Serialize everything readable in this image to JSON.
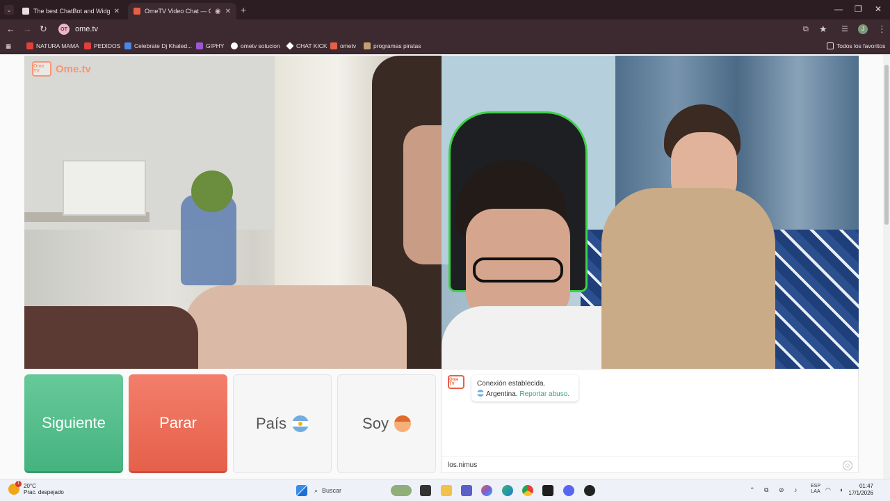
{
  "browser": {
    "tabs": [
      {
        "title": "The best ChatBot and Widgets",
        "active": false
      },
      {
        "title": "OmeTV Video Chat — Ome",
        "active": true
      }
    ],
    "url": "ome.tv",
    "site_badge": "OT"
  },
  "bookmarks": [
    {
      "label": "NATURA MAMA",
      "color": "#e0403a"
    },
    {
      "label": "PEDIDOS",
      "color": "#e0403a"
    },
    {
      "label": "Celebrate Dj Khaled...",
      "color": "#4a86e8"
    },
    {
      "label": "GIPHY",
      "color": "#9b59d0"
    },
    {
      "label": "ometv solucion",
      "color": "#ffffff"
    },
    {
      "label": "CHAT KICK",
      "color": "#ffffff"
    },
    {
      "label": "ometv",
      "color": "#e95f46"
    },
    {
      "label": "programas piratas",
      "color": "#c2a070"
    }
  ],
  "bookmarks_folder": "Todos los favoritos",
  "logo": {
    "badge": "Ome TV",
    "text": "Ome.tv"
  },
  "buttons": {
    "next": "Siguiente",
    "stop": "Parar",
    "country": "País",
    "soy": "Soy"
  },
  "chat": {
    "logo_badge": "Ome TV",
    "status": "Conexión establecida.",
    "country": "Argentina.",
    "report": "Reportar abuso.",
    "input_value": "los.nimus"
  },
  "taskbar": {
    "temperature": "20°C",
    "weather": "Prac. despejado",
    "weather_badge": "1",
    "search": "Buscar",
    "lang_top": "ESP",
    "lang_bottom": "LAA",
    "time": "01:47",
    "date": "17/1/2026"
  },
  "colors": {
    "next": "#55be8b",
    "stop": "#ec6f59",
    "link": "#3aa57a",
    "browser_bg": "#3d2a31"
  }
}
